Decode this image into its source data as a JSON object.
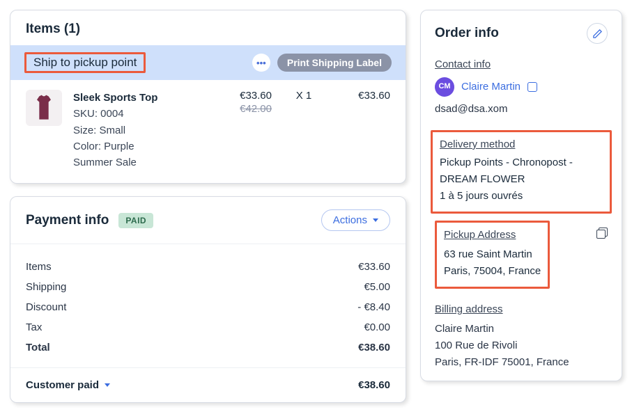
{
  "items_card": {
    "header": "Items (1)",
    "ship_label": "Ship to pickup point",
    "more": "•••",
    "print_label": "Print Shipping Label"
  },
  "product": {
    "name": "Sleek Sports Top",
    "sku": "SKU: 0004",
    "size": "Size: Small",
    "color": "Color: Purple",
    "promo": "Summer Sale",
    "price": "€33.60",
    "original_price": "€42.00",
    "qty": "X 1",
    "line_total": "€33.60"
  },
  "payment": {
    "title": "Payment info",
    "status": "PAID",
    "actions": "Actions",
    "rows": {
      "items_label": "Items",
      "items_value": "€33.60",
      "shipping_label": "Shipping",
      "shipping_value": "€5.00",
      "discount_label": "Discount",
      "discount_value": "- €8.40",
      "tax_label": "Tax",
      "tax_value": "€0.00",
      "total_label": "Total",
      "total_value": "€38.60"
    },
    "customer_paid_label": "Customer paid",
    "customer_paid_value": "€38.60"
  },
  "order_info": {
    "title": "Order info",
    "contact": {
      "label": "Contact info",
      "initials": "CM",
      "name": "Claire Martin",
      "email": "dsad@dsa.xom"
    },
    "delivery": {
      "label": "Delivery method",
      "method": "Pickup Points - Chronopost - DREAM FLOWER",
      "eta": "1 à 5 jours ouvrés"
    },
    "pickup": {
      "label": "Pickup Address",
      "line1": "63 rue Saint Martin",
      "line2": "Paris, 75004, France"
    },
    "billing": {
      "label": "Billing address",
      "name": "Claire Martin",
      "line1": "100 Rue de Rivoli",
      "line2": "Paris, FR-IDF 75001, France"
    }
  }
}
